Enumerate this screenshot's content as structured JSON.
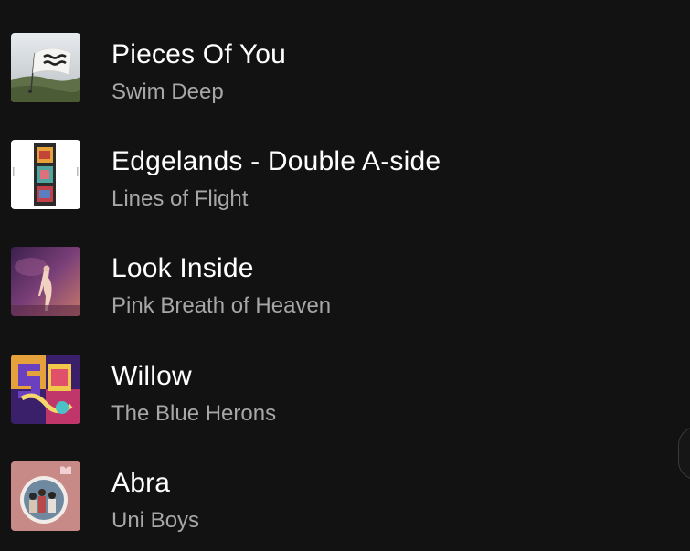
{
  "tracks": [
    {
      "title": "Pieces Of You",
      "artist": "Swim Deep",
      "artwork": "flag-on-hill-artwork"
    },
    {
      "title": "Edgelands - Double A-side",
      "artist": "Lines of Flight",
      "artwork": "film-strip-artwork"
    },
    {
      "title": "Look Inside",
      "artist": "Pink Breath of Heaven",
      "artwork": "figure-in-purple-artwork"
    },
    {
      "title": "Willow",
      "artist": "The Blue Herons",
      "artwork": "psychedelic-letters-artwork"
    },
    {
      "title": "Abra",
      "artist": "Uni Boys",
      "artwork": "band-photo-artwork"
    }
  ],
  "colors": {
    "background": "#121212",
    "title": "#ffffff",
    "subtitle": "#a7a7a7"
  }
}
